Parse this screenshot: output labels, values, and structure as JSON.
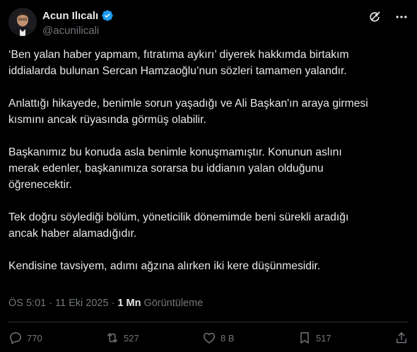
{
  "header": {
    "name": "Acun Ilıcalı",
    "handle": "@acunilicali"
  },
  "icons": {
    "avatar": "profile-photo",
    "verified": "verified-badge-icon",
    "grok": "grok-icon",
    "more": "more-icon"
  },
  "tweet": {
    "paragraphs": [
      "‘Ben yalan haber yapmam, fıtratıma aykırı’ diyerek hakkımda birtakım\niddialarda bulunan Sercan Hamzaoğlu’nun sözleri tamamen yalandır.",
      "Anlattığı hikayede, benimle sorun yaşadığı ve Ali Başkan'ın araya girmesi\nkısmını ancak rüyasında görmüş olabilir.",
      "Başkanımız bu konuda asla benimle konuşmamıştır. Konunun aslını\nmerak edenler, başkanımıza sorarsa bu iddianın yalan olduğunu\nöğrenecektir.",
      "Tek doğru söylediği bölüm, yöneticilik dönemimde beni sürekli aradığı\nancak haber alamadığıdır.",
      "Kendisine tavsiyem, adımı ağzına alırken iki kere düşünmesidir."
    ]
  },
  "meta": {
    "time": "ÖS 5:01",
    "sep1": "·",
    "date": "11 Eki 2025",
    "sep2": "·",
    "views_count": "1 Mn",
    "views_label": "Görüntüleme"
  },
  "actions": {
    "replies": "770",
    "reposts": "527",
    "likes": "8 B",
    "bookmarks": "517"
  },
  "colors": {
    "background": "#000000",
    "text": "#e7e9ea",
    "muted": "#71767b",
    "verified": "#1d9bf0",
    "divider": "#2f3336"
  }
}
